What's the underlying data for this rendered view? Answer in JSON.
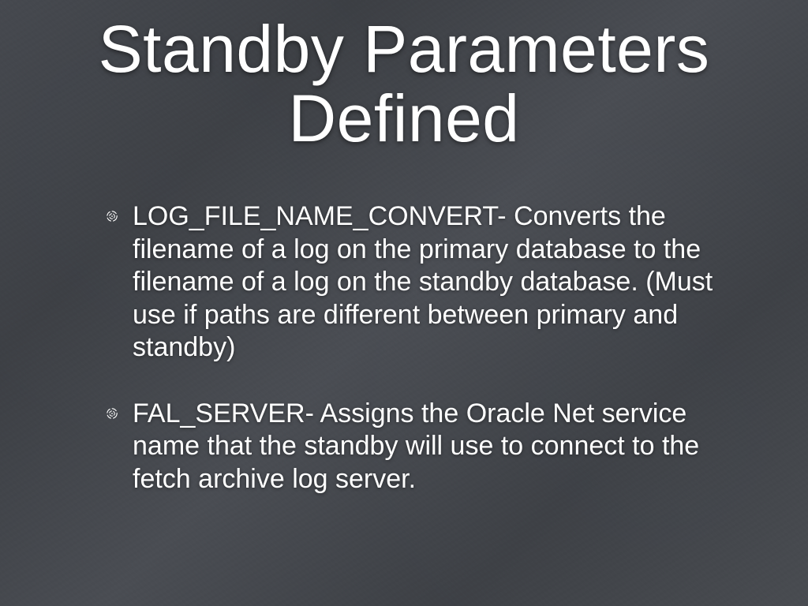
{
  "title": "Standby Parameters Defined",
  "bullets": [
    {
      "text": "LOG_FILE_NAME_CONVERT- Converts the filename of a log on the primary database to the filename of a log on the standby database. (Must use if paths are different between primary and standby)"
    },
    {
      "text": "FAL_SERVER- Assigns the Oracle Net service name that the standby will use to connect to the fetch archive log server."
    }
  ]
}
